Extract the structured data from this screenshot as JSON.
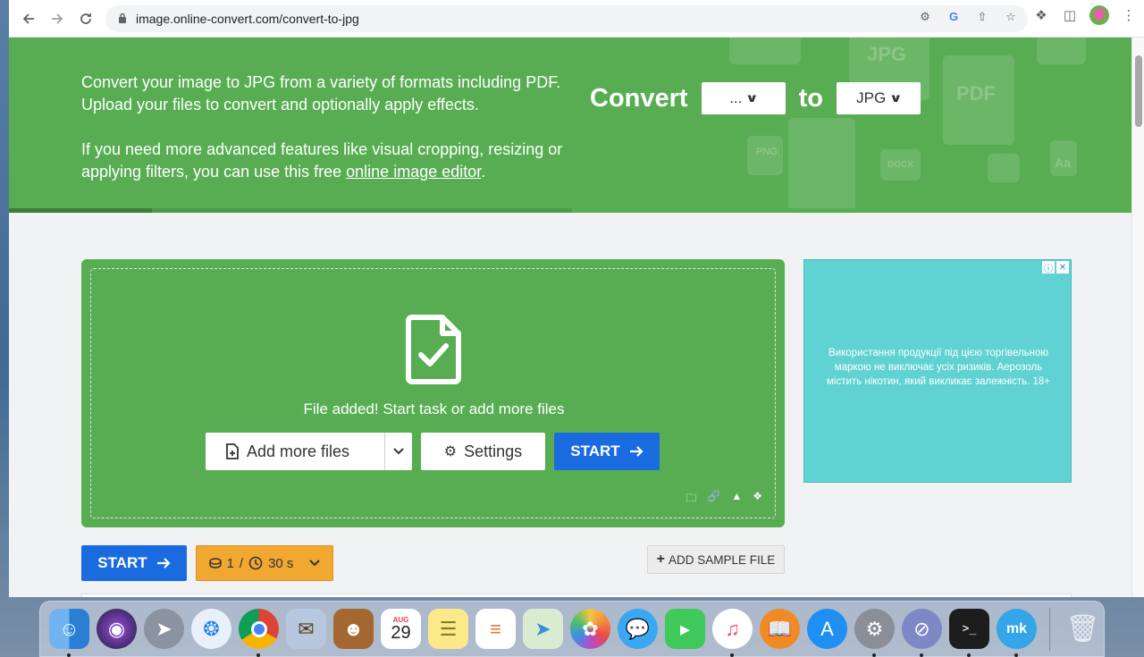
{
  "browser": {
    "url": "image.online-convert.com/convert-to-jpg",
    "back_icon": "arrow-left-icon",
    "forward_icon": "arrow-right-icon",
    "reload_icon": "reload-icon"
  },
  "hero": {
    "paragraph1": "Convert your image to JPG from a variety of formats including PDF. Upload your files to convert and optionally apply effects.",
    "paragraph2_prefix": "If you need more advanced features like visual cropping, resizing or applying filters, you can use this free ",
    "paragraph2_link": "online image editor",
    "paragraph2_suffix": ".",
    "convert_label": "Convert",
    "from_value": "...",
    "to_label": "to",
    "to_value": "JPG",
    "deco_labels": [
      "JPG",
      "PDF",
      "PNG",
      "DOCX",
      "Aa"
    ]
  },
  "upload": {
    "message": "File added! Start task or add more files",
    "add_more_label": "Add more files",
    "settings_label": "Settings",
    "start_label": "START"
  },
  "ad": {
    "text": "Використання продукції під цією торгівельною маркою не виключає усіх ризиків. Аерозоль містить нікотин, який викликає залежність. 18+"
  },
  "bottom": {
    "start_label": "START",
    "credits_count": "1",
    "credits_sep": "/",
    "time_value": "30 s",
    "sample_label": "ADD SAMPLE FILE"
  },
  "dock": {
    "calendar_month": "AUG",
    "calendar_day": "29"
  },
  "colors": {
    "brand_green": "#58ad53",
    "start_blue": "#1a6be0",
    "credits_orange": "#f0a830",
    "ad_teal": "#60d2d3"
  }
}
